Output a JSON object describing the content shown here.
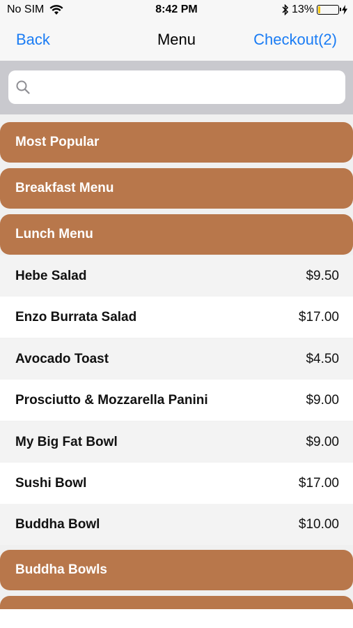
{
  "status_bar": {
    "carrier": "No SIM",
    "time": "8:42 PM",
    "battery_percent": "13%",
    "battery_level": 0.13,
    "icons": [
      "wifi-icon",
      "bluetooth-icon",
      "battery-icon",
      "charging-icon"
    ]
  },
  "nav": {
    "back_label": "Back",
    "title": "Menu",
    "checkout_label": "Checkout(2)",
    "accent_color": "#1a7cf4"
  },
  "search": {
    "placeholder": "",
    "value": ""
  },
  "categories": {
    "most_popular": "Most Popular",
    "breakfast": "Breakfast Menu",
    "lunch": "Lunch Menu",
    "buddha_bowls": "Buddha Bowls",
    "partial": ""
  },
  "lunch_items": [
    {
      "name": "Hebe Salad",
      "price": "$9.50"
    },
    {
      "name": "Enzo Burrata Salad",
      "price": "$17.00"
    },
    {
      "name": "Avocado Toast",
      "price": "$4.50"
    },
    {
      "name": "Prosciutto & Mozzarella Panini",
      "price": "$9.00"
    },
    {
      "name": "My Big Fat Bowl",
      "price": "$9.00"
    },
    {
      "name": "Sushi Bowl",
      "price": "$17.00"
    },
    {
      "name": "Buddha Bowl",
      "price": "$10.00"
    }
  ],
  "colors": {
    "category_bg": "#b8774b",
    "category_text": "#ffffff",
    "search_bar_bg": "#c9c9ce"
  }
}
